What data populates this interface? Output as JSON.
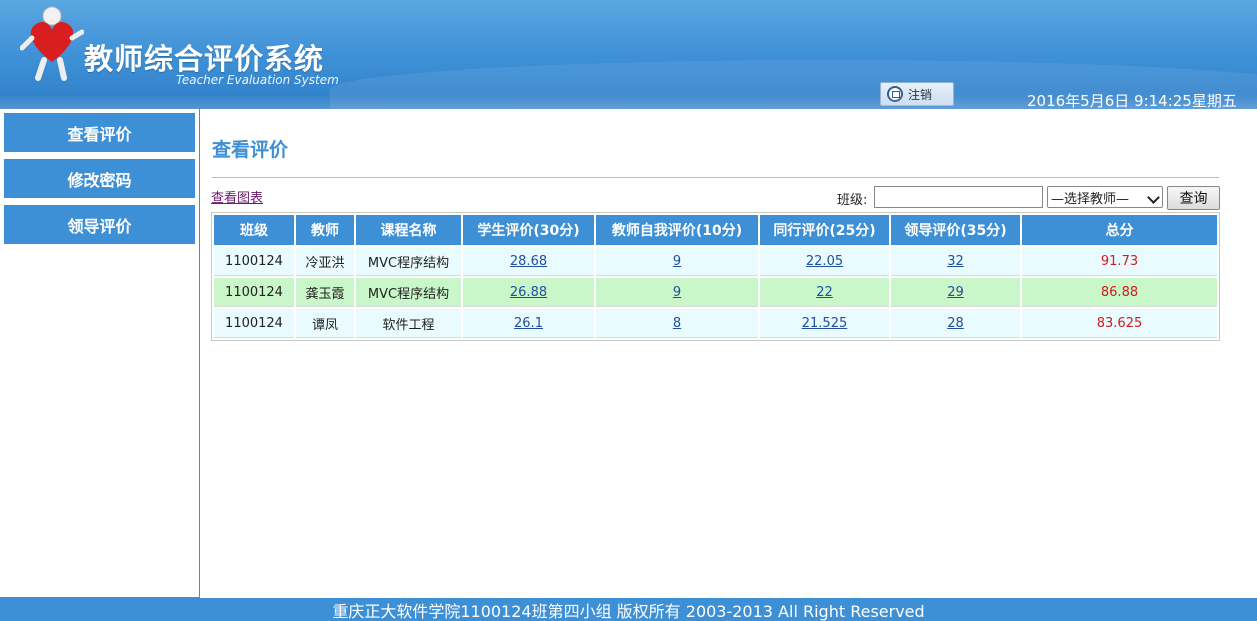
{
  "header": {
    "title": "教师综合评价系统",
    "subtitle": "Teacher Evaluation System",
    "logout_label": "注销",
    "datetime": "2016年5月6日 9:14:25星期五"
  },
  "sidebar": {
    "items": [
      {
        "label": "查看评价"
      },
      {
        "label": "修改密码"
      },
      {
        "label": "领导评价"
      }
    ]
  },
  "main": {
    "page_title": "查看评价",
    "chart_link": "查看图表",
    "class_label": "班级:",
    "class_input_value": "",
    "teacher_select_value": "—选择教师—",
    "query_label": "查询",
    "table": {
      "headers": [
        "班级",
        "教师",
        "课程名称",
        "学生评价(30分)",
        "教师自我评价(10分)",
        "同行评价(25分)",
        "领导评价(35分)",
        "总分"
      ],
      "rows": [
        [
          "1100124",
          "冷亚洪",
          "MVC程序结构",
          "28.68",
          "9",
          "22.05",
          "32",
          "91.73"
        ],
        [
          "1100124",
          "龚玉霞",
          "MVC程序结构",
          "26.88",
          "9",
          "22",
          "29",
          "86.88"
        ],
        [
          "1100124",
          "谭凤",
          "软件工程",
          "26.1",
          "8",
          "21.525",
          "28",
          "83.625"
        ]
      ]
    }
  },
  "footer": {
    "text": "重庆正大软件学院1100124班第四小组 版权所有 2003-2013 All Right Reserved"
  }
}
